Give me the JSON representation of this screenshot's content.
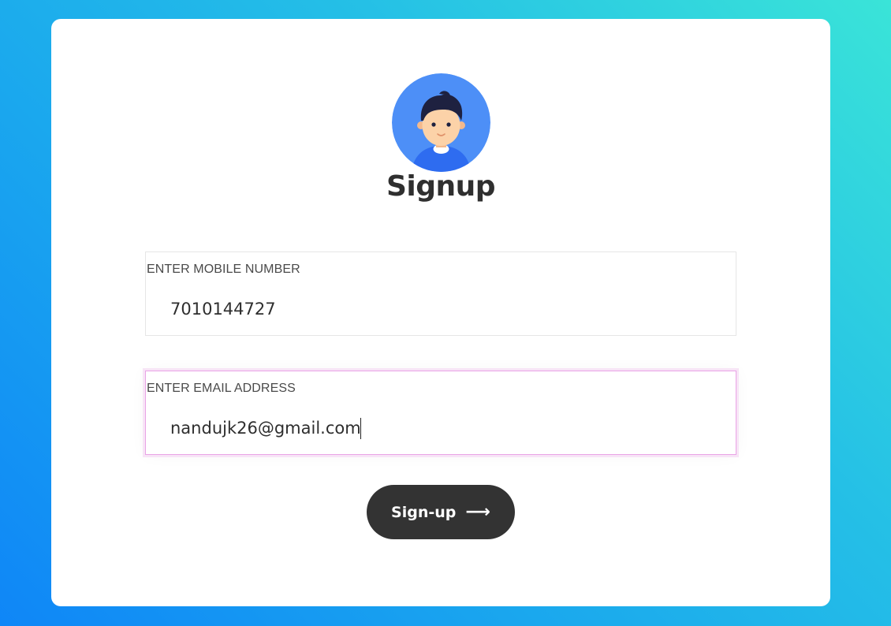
{
  "page": {
    "title": "Signup"
  },
  "avatar": {
    "icon": "user-avatar-icon",
    "bg_color": "#4d8ff7"
  },
  "form": {
    "mobile": {
      "label": "ENTER MOBILE NUMBER",
      "value": "7010144727",
      "type": "tel"
    },
    "email": {
      "label": "ENTER EMAIL ADDRESS",
      "value": "nandujk26@gmail.com",
      "type": "email",
      "focused": true
    },
    "submit": {
      "label": "Sign-up",
      "icon": "arrow-right-icon",
      "icon_glyph": "⟶"
    }
  },
  "colors": {
    "background_gradient_start": "#3ae4d8",
    "background_gradient_end": "#0f86f7",
    "button_bg": "#333333",
    "focus_border": "#e9a3e6"
  }
}
